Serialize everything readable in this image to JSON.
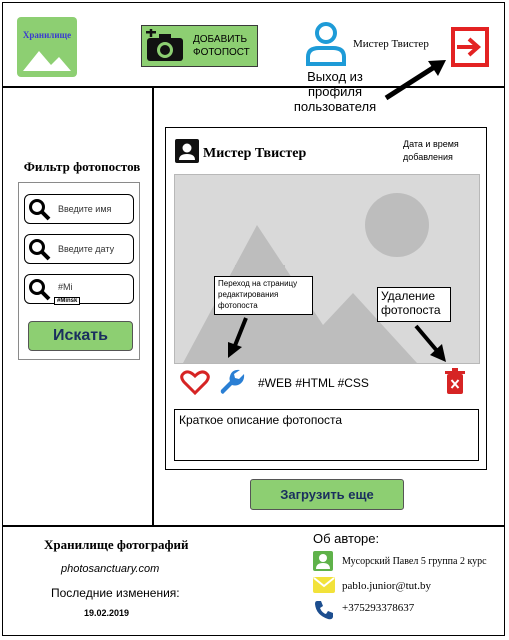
{
  "header": {
    "logo_text": "Хранилище",
    "add_button_label_1": "ДОБАВИТЬ",
    "add_button_label_2": "ФОТОПОСТ",
    "user_name": "Мистер Твистер"
  },
  "annotations": {
    "logout_1": "Выход из",
    "logout_2": "профиля",
    "logout_3": "пользователя"
  },
  "filter": {
    "title": "Фильтр фотопостов",
    "name_placeholder": "Введите имя",
    "date_placeholder": "Введите дату",
    "tag_value": "#Mi",
    "tag_suggestion": "#Minsk",
    "search_label": "Искать"
  },
  "post": {
    "author": "Мистер Твистер",
    "date_1": "Дата и время",
    "date_2": "добавления",
    "edit_callout_1": "Переход на страницу",
    "edit_callout_2": "редактирования",
    "edit_callout_3": "фотопоста",
    "delete_callout_1": "Удаление",
    "delete_callout_2": "фотопоста",
    "tags": "#WEB #HTML #CSS",
    "description": "Краткое описание фотопоста"
  },
  "load_more_label": "Загрузить еще",
  "footer": {
    "title": "Хранилище фотографий",
    "site": "photosanctuary.com",
    "changes_label": "Последние изменения:",
    "changes_date": "19.02.2019",
    "about_label": "Об авторе:",
    "author": "Мусорский Павел 5 группа 2 курс",
    "email": "pablo.junior@tut.by",
    "phone": "+375293378637"
  },
  "colors": {
    "accent_green": "#8dcf72",
    "user_icon_blue": "#1e9bd7",
    "logout_red": "#e32222",
    "heart_red": "#d62424",
    "wrench_blue": "#2a7fd4"
  }
}
